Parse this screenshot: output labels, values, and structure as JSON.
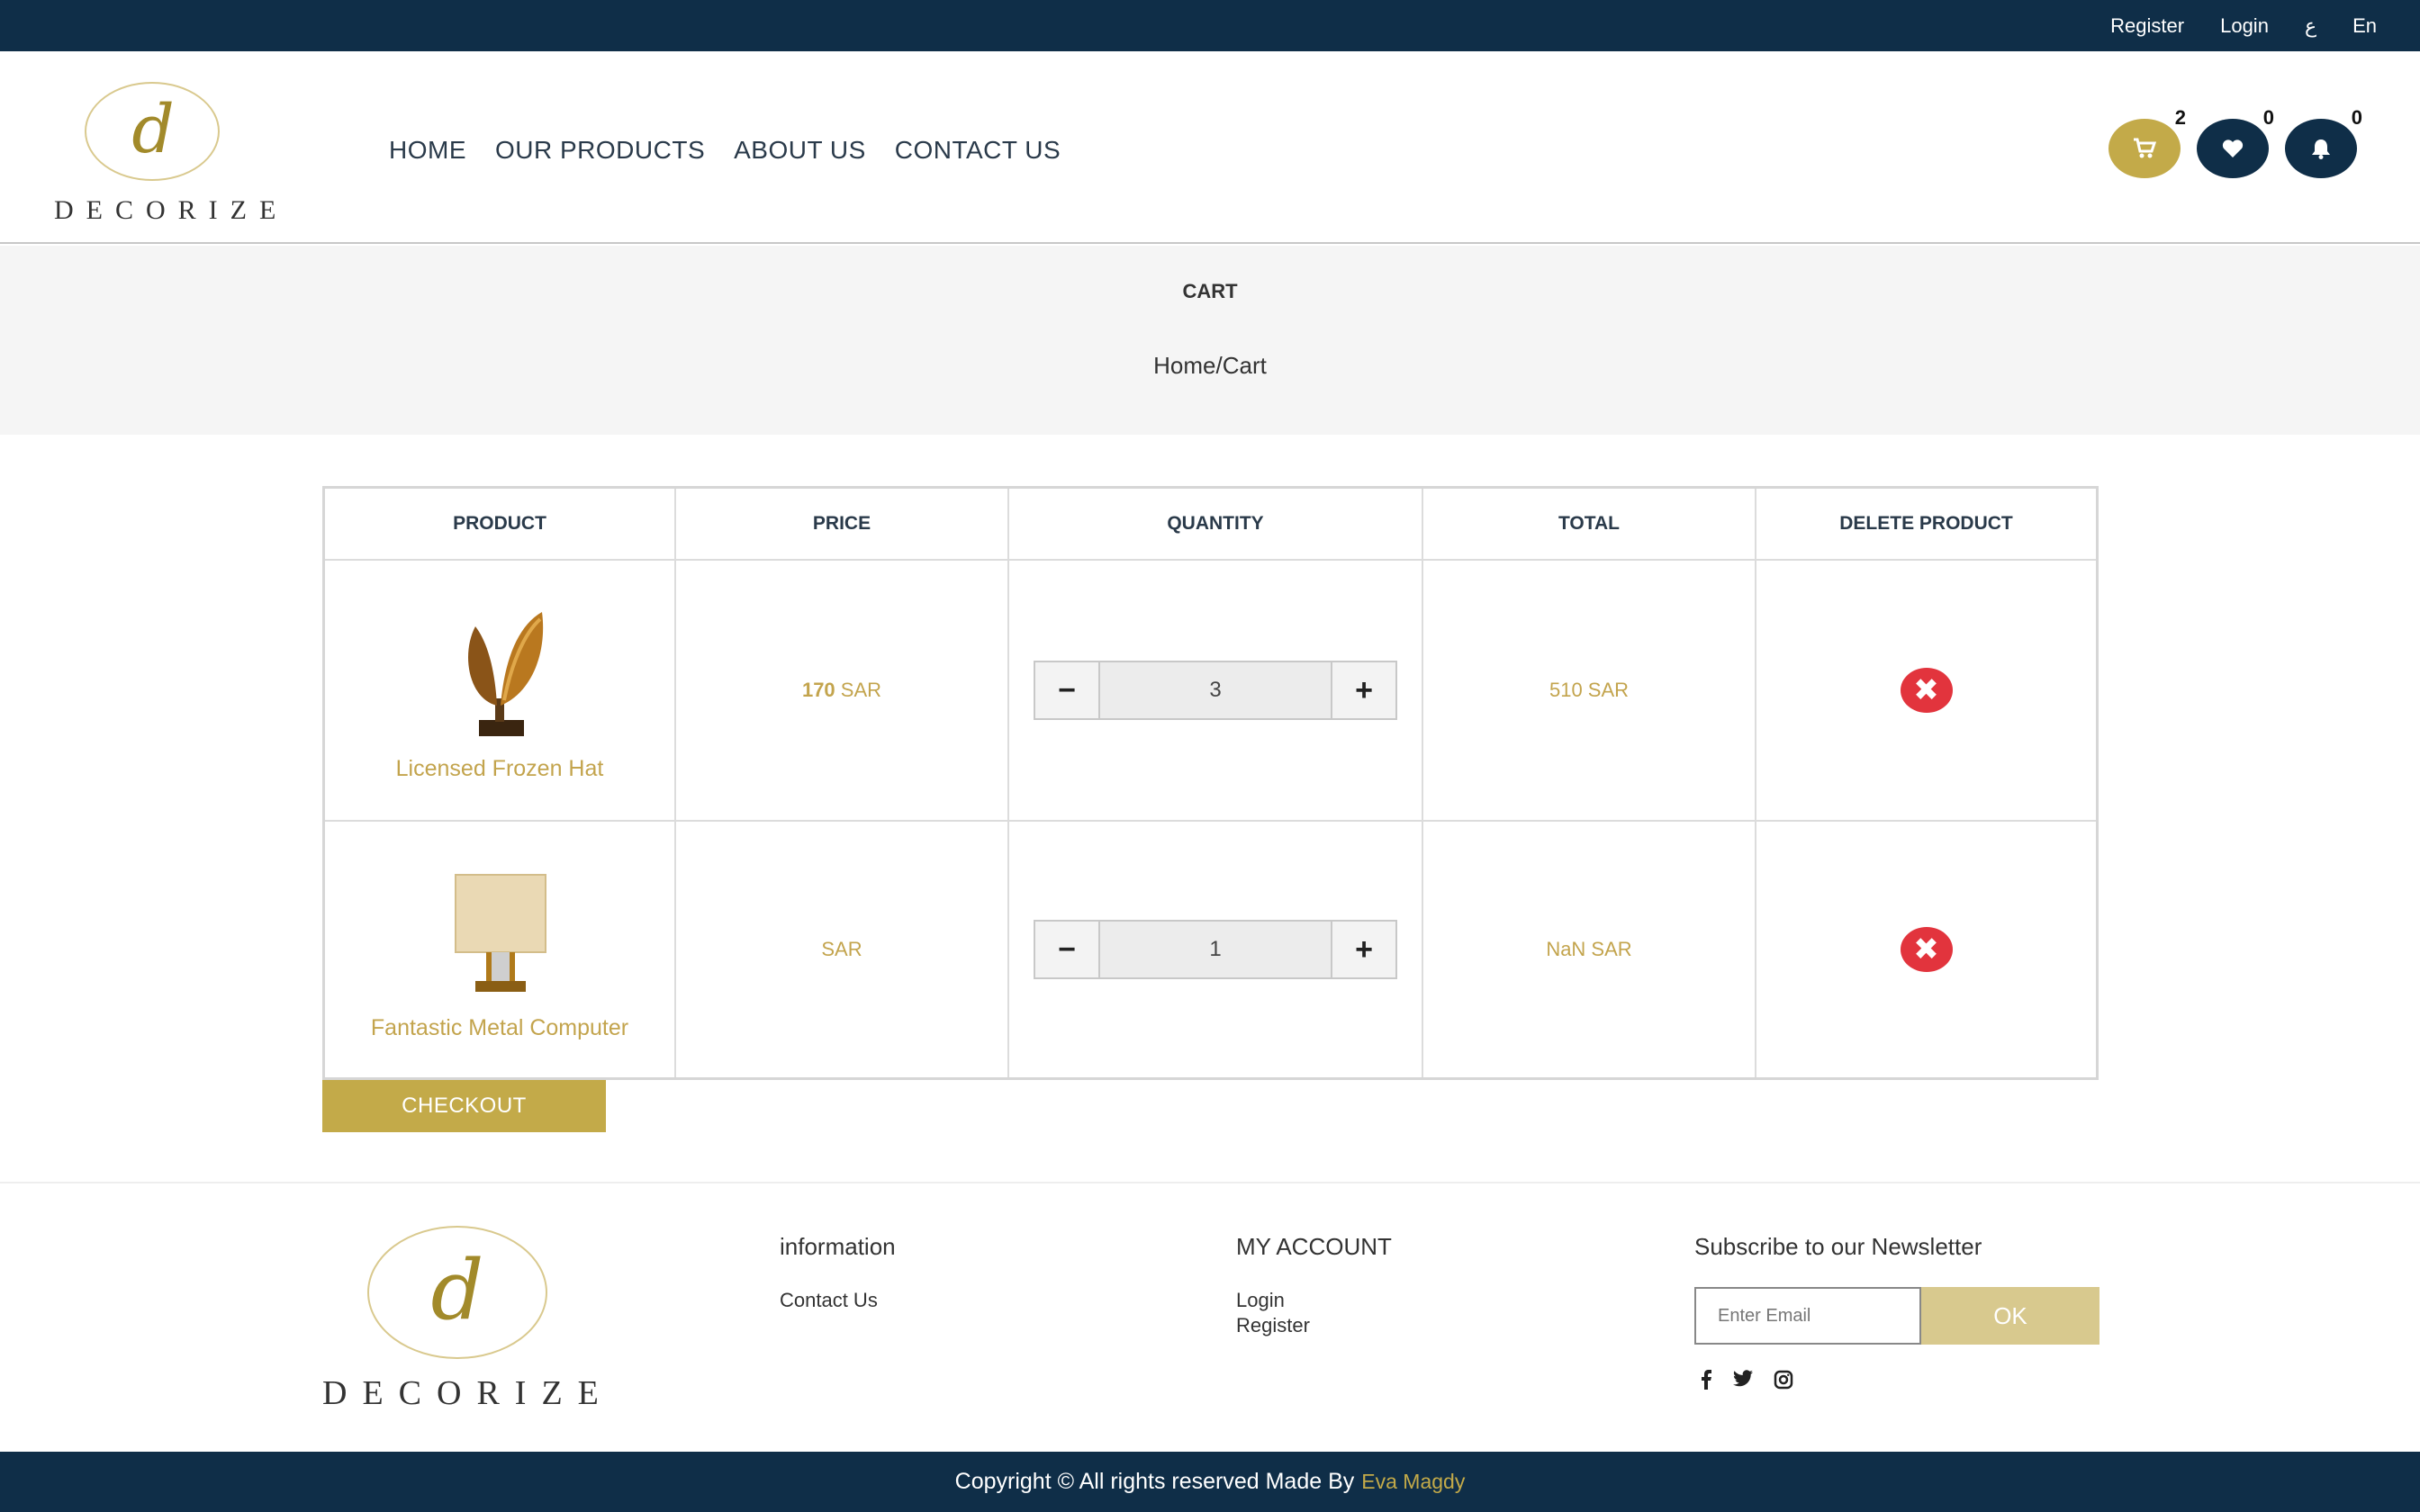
{
  "topbar": {
    "register": "Register",
    "login": "Login",
    "arabic": "ع",
    "english": "En"
  },
  "logo": {
    "letter": "d",
    "word": "DECORIZE"
  },
  "nav": {
    "home": "HOME",
    "products": "OUR PRODUCTS",
    "about": "ABOUT US",
    "contact": "CONTACT US"
  },
  "header_icons": {
    "cart": {
      "icon": "cart-icon",
      "count": "2"
    },
    "wishlist": {
      "icon": "heart-icon",
      "count": "0"
    },
    "notifications": {
      "icon": "bell-icon",
      "count": "0"
    }
  },
  "band": {
    "title": "CART",
    "breadcrumb": "Home/Cart"
  },
  "cart": {
    "headers": [
      "PRODUCT",
      "PRICE",
      "QUANTITY",
      "TOTAL",
      "DELETE PRODUCT"
    ],
    "items": [
      {
        "name": "Licensed Frozen Hat",
        "price_value": "170",
        "price_currency": "SAR",
        "quantity": "3",
        "total": "510 SAR"
      },
      {
        "name": "Fantastic Metal Computer",
        "price_value": "",
        "price_currency": "SAR",
        "quantity": "1",
        "total": "NaN SAR"
      }
    ],
    "minus": "−",
    "plus": "+",
    "delete_glyph": "✖"
  },
  "checkout_label": "CHECKOUT",
  "footer": {
    "info_title": "information",
    "info_links": [
      "Contact Us"
    ],
    "account_title": "MY ACCOUNT",
    "account_links": [
      "Login",
      "Register"
    ],
    "newsletter_title": "Subscribe to our Newsletter",
    "newsletter_placeholder": "Enter Email",
    "newsletter_button": "OK",
    "social": [
      "facebook-icon",
      "twitter-icon",
      "instagram-icon"
    ],
    "copyright": "Copyright © All rights reserved Made By",
    "author": "Eva Magdy"
  },
  "colors": {
    "navy": "#0f2e48",
    "gold": "#c3aa49",
    "delete_red": "#e2343d"
  }
}
